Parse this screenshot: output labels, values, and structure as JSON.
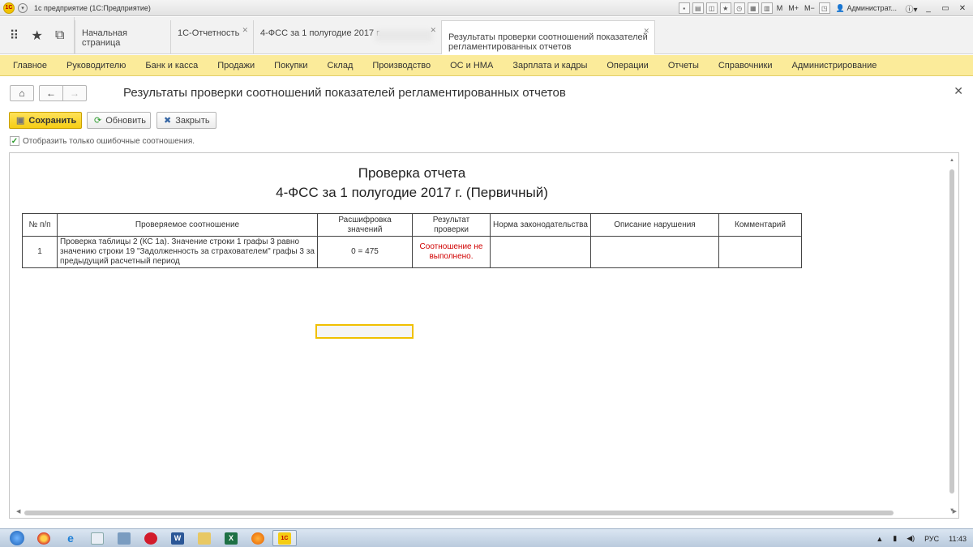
{
  "window": {
    "title": "1с предприятие  (1С:Предприятие)",
    "logo_text": "1С",
    "user": "Администрат...",
    "m_buttons": [
      "M",
      "M+",
      "M−"
    ]
  },
  "tabs": [
    {
      "label": "Начальная страница",
      "closable": false
    },
    {
      "label": "1С-Отчетность",
      "closable": true
    },
    {
      "label": "4-ФСС за 1 полугодие 2017 г.",
      "closable": true
    },
    {
      "label": "Результаты проверки соотношений показателей регламентированных отчетов",
      "closable": true,
      "active": true
    }
  ],
  "menu": [
    "Главное",
    "Руководителю",
    "Банк и касса",
    "Продажи",
    "Покупки",
    "Склад",
    "Производство",
    "ОС и НМА",
    "Зарплата и кадры",
    "Операции",
    "Отчеты",
    "Справочники",
    "Администрирование"
  ],
  "form": {
    "title": "Результаты проверки соотношений показателей регламентированных отчетов",
    "buttons": {
      "save": "Сохранить",
      "refresh": "Обновить",
      "close": "Закрыть"
    },
    "only_errors_label": "Отобразить только ошибочные соотношения.",
    "only_errors_checked": true
  },
  "report": {
    "title_line1": "Проверка отчета",
    "title_line2": "4-ФСС за 1 полугодие 2017 г. (Первичный)",
    "columns": [
      "№ п/п",
      "Проверяемое соотношение",
      "Расшифровка значений",
      "Результат проверки",
      "Норма законодательства",
      "Описание нарушения",
      "Комментарий"
    ],
    "rows": [
      {
        "num": "1",
        "relation": "Проверка таблицы 2 (КС 1а). Значение строки 1 графы 3 равно значению строки 19 \"Задолженность за страхователем\" графы 3 за предыдущий расчетный период",
        "values": "0 = 475",
        "result": "Соотношение не выполнено.",
        "norm": "",
        "violation": "",
        "comment": ""
      }
    ]
  },
  "taskbar": {
    "lang": "РУС",
    "time": "11:43"
  }
}
